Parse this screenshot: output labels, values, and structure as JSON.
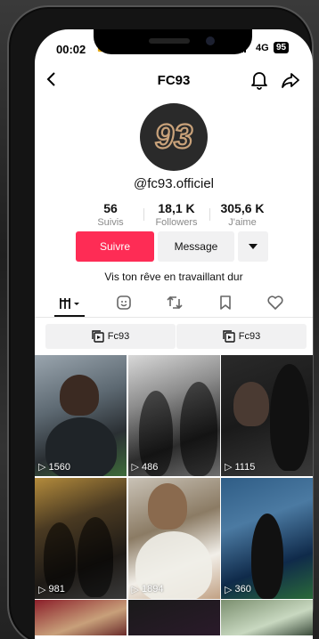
{
  "status_bar": {
    "time": "00:02",
    "network": "4G",
    "battery": "95"
  },
  "header": {
    "title": "FC93"
  },
  "profile": {
    "handle": "@fc93.officiel",
    "logo_text": "93",
    "stats": [
      {
        "value": "56",
        "label": "Suivis"
      },
      {
        "value": "18,1 K",
        "label": "Followers"
      },
      {
        "value": "305,6 K",
        "label": "J'aime"
      }
    ],
    "follow_label": "Suivre",
    "message_label": "Message",
    "bio": "Vis ton rêve en travaillant dur"
  },
  "tabs": [
    "videos-grid-icon",
    "favorites-icon",
    "repost-icon",
    "bookmark-icon",
    "heart-icon"
  ],
  "playlists": [
    {
      "label": "Fc93"
    },
    {
      "label": "Fc93"
    }
  ],
  "videos": [
    {
      "views": "1560"
    },
    {
      "views": "486"
    },
    {
      "views": "1115"
    },
    {
      "views": "981"
    },
    {
      "views": "1894"
    },
    {
      "views": "360"
    },
    {
      "views": ""
    },
    {
      "views": ""
    },
    {
      "views": ""
    }
  ],
  "colors": {
    "accent": "#fe2c55",
    "logo_gold": "#c9a27a"
  }
}
